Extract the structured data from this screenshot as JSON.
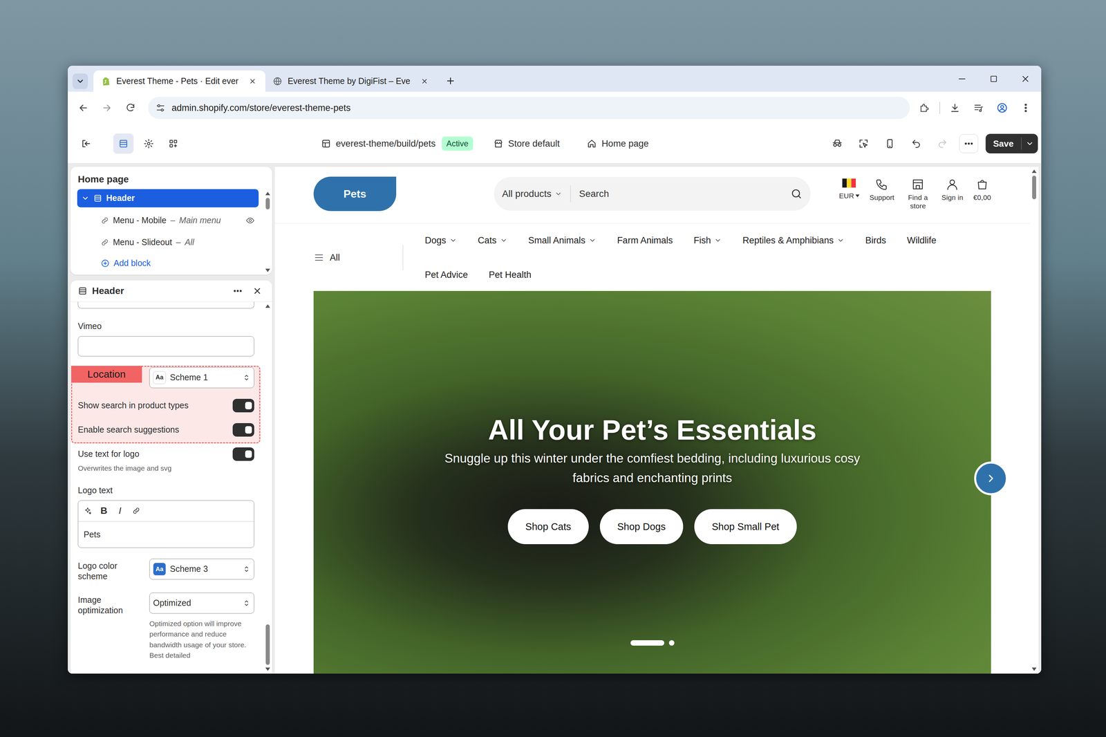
{
  "browser": {
    "tabs": [
      {
        "label": "Everest Theme - Pets · Edit ever",
        "selected": true
      },
      {
        "label": "Everest Theme by DigiFist – Eve",
        "selected": false
      }
    ],
    "url": "admin.shopify.com/store/everest-theme-pets"
  },
  "toolbar": {
    "theme": "everest-theme/build/pets",
    "status": "Active",
    "store": "Store default",
    "page": "Home page",
    "save": "Save"
  },
  "sections": {
    "title": "Home page",
    "separator": "–",
    "items": [
      {
        "label": "Header",
        "kind": "section",
        "selected": true,
        "expanded": true
      },
      {
        "label": "Menu - Mobile",
        "detail": "Main menu",
        "kind": "block",
        "selected": false,
        "visibility_icon": true
      },
      {
        "label": "Menu - Slideout",
        "detail": "All",
        "kind": "block",
        "selected": false,
        "visibility_icon": false
      }
    ],
    "add_block": "Add block"
  },
  "settings": {
    "title": "Header",
    "fields": [
      {
        "kind": "text",
        "label": "Vimeo",
        "value": "",
        "highlighted": false
      },
      {
        "kind": "select",
        "value": "Scheme 1",
        "swatch": "Aa",
        "swatch_color": "#ffffff",
        "highlighted": true
      },
      {
        "kind": "toggle",
        "label": "Show search in product types",
        "on": true,
        "highlighted": true
      },
      {
        "kind": "toggle",
        "label": "Enable search suggestions",
        "on": true,
        "highlighted": true
      },
      {
        "kind": "toggle",
        "label": "Use text for logo",
        "on": true,
        "help": "Overwrites the image and svg",
        "highlighted": false
      },
      {
        "kind": "richtext",
        "label": "Logo text",
        "value": "Pets",
        "toolbar": [
          {
            "label": "B",
            "kind": "bold"
          },
          {
            "label": "I",
            "kind": "italic"
          }
        ],
        "highlighted": false
      },
      {
        "kind": "select",
        "label": "Logo color scheme",
        "value": "Scheme 3",
        "swatch": "Aa",
        "swatch_color": "#2c6ecb",
        "highlighted": false
      },
      {
        "kind": "select",
        "label": "Image optimization",
        "value": "Optimized",
        "help": "Optimized option will improve performance and reduce bandwidth usage of your store. Best detailed",
        "highlighted": false
      }
    ]
  },
  "annotation": {
    "label": "Location"
  },
  "storefront": {
    "logo": "Pets",
    "search": {
      "category": "All products",
      "placeholder": "Search"
    },
    "actions": [
      {
        "label": "EUR",
        "kind": "currency"
      },
      {
        "label": "Support",
        "kind": "phone"
      },
      {
        "label": "Find a store",
        "kind": "store"
      },
      {
        "label": "Sign in",
        "kind": "account"
      },
      {
        "label": "€0,00",
        "kind": "cart"
      }
    ],
    "all_menu": "All",
    "nav": [
      {
        "label": "Dogs",
        "dropdown": true
      },
      {
        "label": "Cats",
        "dropdown": true
      },
      {
        "label": "Small Animals",
        "dropdown": true
      },
      {
        "label": "Farm Animals",
        "dropdown": false
      },
      {
        "label": "Fish",
        "dropdown": true
      },
      {
        "label": "Reptiles & Amphibians",
        "dropdown": true
      },
      {
        "label": "Birds",
        "dropdown": false
      },
      {
        "label": "Wildlife",
        "dropdown": false
      },
      {
        "label": "Pet Advice",
        "dropdown": false
      },
      {
        "label": "Pet Health",
        "dropdown": false
      }
    ],
    "hero": {
      "heading": "All Your Pet’s Essentials",
      "text": "Snuggle up this winter under the comfiest bedding, including luxurious cosy fabrics and enchanting prints",
      "buttons": [
        "Shop Cats",
        "Shop Dogs",
        "Shop Small Pet"
      ],
      "slides": [
        {
          "selected": true
        },
        {
          "selected": false
        }
      ]
    }
  }
}
